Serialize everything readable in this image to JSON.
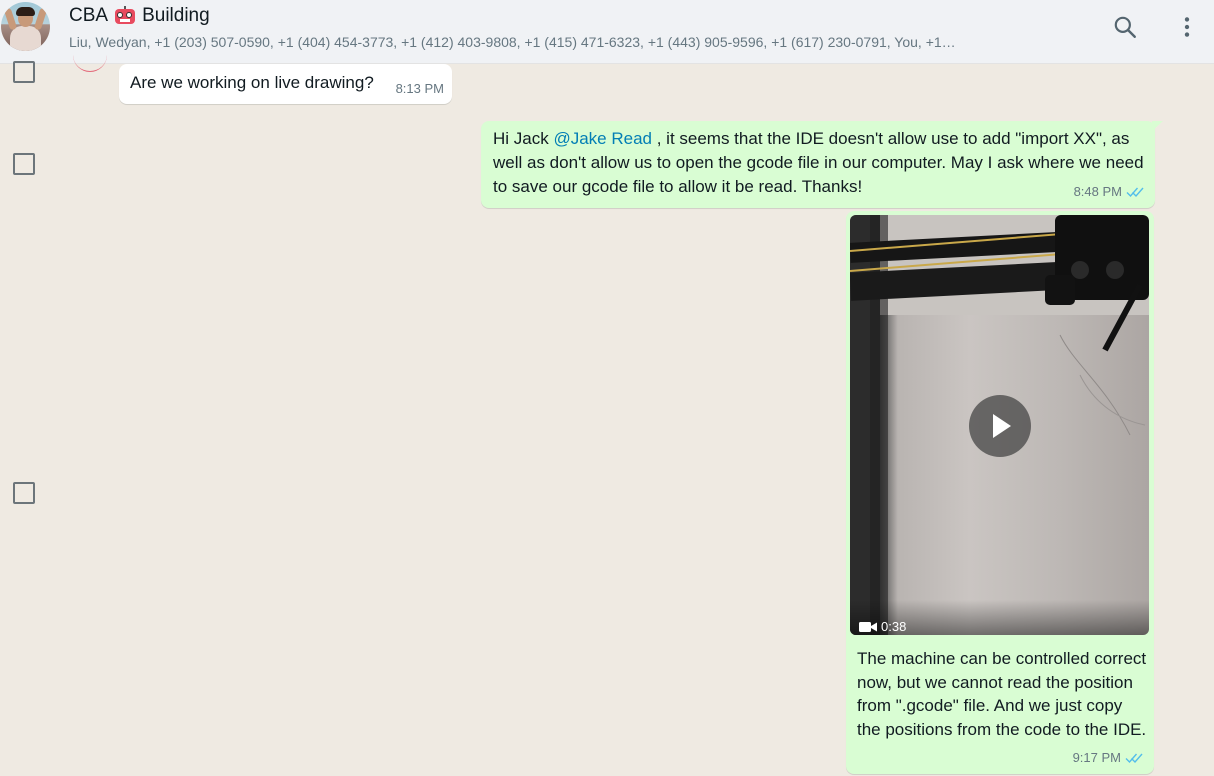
{
  "header": {
    "title_prefix": "CBA",
    "title_suffix": "Building",
    "emoji": "robot-face-icon",
    "subtitle": "Liu, Wedyan, +1 (203) 507-0590, +1 (404) 454-3773, +1 (412) 403-9808, +1 (415) 471-6323, +1 (443) 905-9596, +1 (617) 230-0791, You, +1…",
    "search_icon": "search-icon",
    "menu_icon": "kebab-menu-icon"
  },
  "messages": [
    {
      "direction": "incoming",
      "text": "Are we working on live drawing?",
      "time": "8:13 PM"
    },
    {
      "direction": "outgoing",
      "text_before_mention": "Hi Jack ",
      "mention": "@Jake Read",
      "text_after_mention": " , it seems that the IDE doesn't allow use to add \"import XX\", as well as don't allow us to open the gcode file in our computer. May I ask where we need to save our gcode file to allow it be read. Thanks!",
      "time": "8:48 PM",
      "status": "read"
    },
    {
      "direction": "outgoing",
      "type": "video",
      "duration": "0:38",
      "caption": "The machine can be controlled correct now, but we cannot read the position from \".gcode\" file. And we just copy the positions from the code to the IDE.",
      "time": "9:17 PM",
      "status": "read"
    }
  ],
  "colors": {
    "background": "#efeae2",
    "header_bg": "#f0f2f5",
    "incoming_bubble": "#ffffff",
    "outgoing_bubble": "#d9fdd3",
    "mention": "#027eb5",
    "read_ticks": "#53bdeb",
    "meta_text": "#667781"
  }
}
